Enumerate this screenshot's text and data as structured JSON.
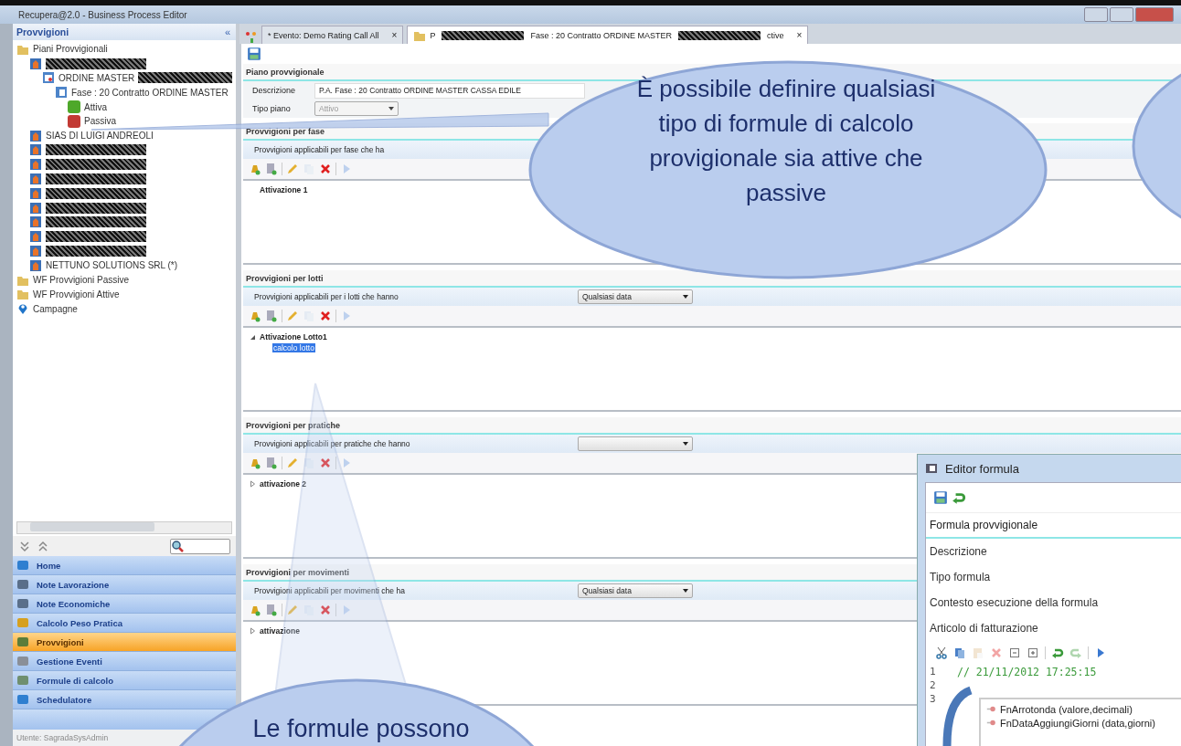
{
  "window": {
    "title": "Recupera@2.0 - Business Process Editor"
  },
  "sidebar": {
    "title": "Provvigioni",
    "collapse_glyph": "«",
    "tree": [
      {
        "kind": "folder",
        "label": "Piani Provvigionali",
        "children": [
          {
            "kind": "company",
            "redacted": true,
            "children": [
              {
                "kind": "order",
                "label": "ORDINE MASTER",
                "redacted": true,
                "children": [
                  {
                    "kind": "phase",
                    "label": "Fase : 20 Contratto ORDINE MASTER",
                    "children": [
                      {
                        "kind": "status",
                        "label": "Attiva",
                        "color": "#4ea82a"
                      },
                      {
                        "kind": "status",
                        "label": "Passiva",
                        "color": "#c23a34"
                      }
                    ]
                  }
                ]
              }
            ]
          },
          {
            "kind": "company",
            "label": "SIAS DI LUIGI ANDREOLI"
          },
          {
            "kind": "company",
            "redacted": true
          },
          {
            "kind": "company",
            "redacted": true
          },
          {
            "kind": "company",
            "redacted": true
          },
          {
            "kind": "company",
            "redacted": true
          },
          {
            "kind": "company",
            "redacted": true
          },
          {
            "kind": "company",
            "redacted": true
          },
          {
            "kind": "company",
            "redacted": true
          },
          {
            "kind": "company",
            "redacted": true
          },
          {
            "kind": "company",
            "label": "NETTUNO SOLUTIONS SRL (*)"
          }
        ]
      },
      {
        "kind": "folder",
        "label": "WF Provvigioni Passive"
      },
      {
        "kind": "folder",
        "label": "WF Provvigioni Attive"
      },
      {
        "kind": "pin",
        "label": "Campagne"
      }
    ],
    "nav": [
      {
        "label": "Home",
        "selected": false
      },
      {
        "label": "Note Lavorazione",
        "selected": false
      },
      {
        "label": "Note Economiche",
        "selected": false
      },
      {
        "label": "Calcolo Peso Pratica",
        "selected": false
      },
      {
        "label": "Provvigioni",
        "selected": true
      },
      {
        "label": "Gestione Eventi",
        "selected": false
      },
      {
        "label": "Formule di calcolo",
        "selected": false
      },
      {
        "label": "Schedulatore",
        "selected": false
      }
    ],
    "status": "Utente: SagradaSysAdmin"
  },
  "tabs": [
    {
      "selected": false,
      "close": "×",
      "segments": [
        {
          "kind": "text",
          "text": "* Evento: Demo Rating Call All"
        }
      ]
    },
    {
      "selected": true,
      "close": "×",
      "segments": [
        {
          "kind": "text",
          "text": "P"
        },
        {
          "kind": "redacted"
        },
        {
          "kind": "text",
          "text": "Fase : 20 Contratto ORDINE MASTER"
        },
        {
          "kind": "redacted"
        },
        {
          "kind": "text",
          "text": "ctive"
        }
      ]
    }
  ],
  "plan": {
    "title": "Piano provvigionale",
    "fields": [
      {
        "label": "Descrizione",
        "kind": "text",
        "value": "P.A. Fase : 20 Contratto ORDINE MASTER CASSA EDILE"
      },
      {
        "label": "Tipo piano",
        "kind": "select",
        "value": "Attivo",
        "disabled": true
      }
    ]
  },
  "sections": [
    {
      "title": "Provvigioni per fase",
      "filter": "Provvigioni applicabili per fase che ha",
      "items": [
        {
          "label": "Attivazione 1"
        }
      ]
    },
    {
      "title": "Provvigioni per lotti",
      "filter": "Provvigioni applicabili per i lotti che hanno",
      "dropdown": true,
      "dropdown_value": "Qualsiasi data",
      "items": [
        {
          "label": "Attivazione Lotto1",
          "expanded": true,
          "children": [
            {
              "label": "calcolo lotto",
              "selected": true
            }
          ]
        }
      ]
    },
    {
      "title": "Provvigioni per pratiche",
      "filter": "Provvigioni applicabili per pratiche che hanno",
      "dropdown": true,
      "items": [
        {
          "label": "attivazione 2",
          "expanded": false
        }
      ]
    },
    {
      "title": "Provvigioni per movimenti",
      "filter": "Provvigioni applicabili per movimenti che ha",
      "dropdown": true,
      "dropdown_value": "Qualsiasi data",
      "items": [
        {
          "label": "attivazione",
          "expanded": false
        }
      ]
    }
  ],
  "editor": {
    "title": "Editor formula",
    "heading": "Formula provvigionale",
    "fields": [
      "Descrizione",
      "Tipo formula",
      "Contesto esecuzione della formula",
      "Articolo di fatturazione"
    ],
    "code": [
      {
        "line": "1",
        "text": "// 21/11/2012 17:25:15"
      },
      {
        "line": "2"
      },
      {
        "line": "3"
      }
    ],
    "completions": [
      "FnArrotonda (valore,decimali)",
      "FnDataAggiungiGiorni (data,giorni)"
    ]
  },
  "callouts": [
    "È possibile definire qualsiasi tipo di formule di calcolo provigionale sia attive che passive",
    "Le formule possono"
  ]
}
